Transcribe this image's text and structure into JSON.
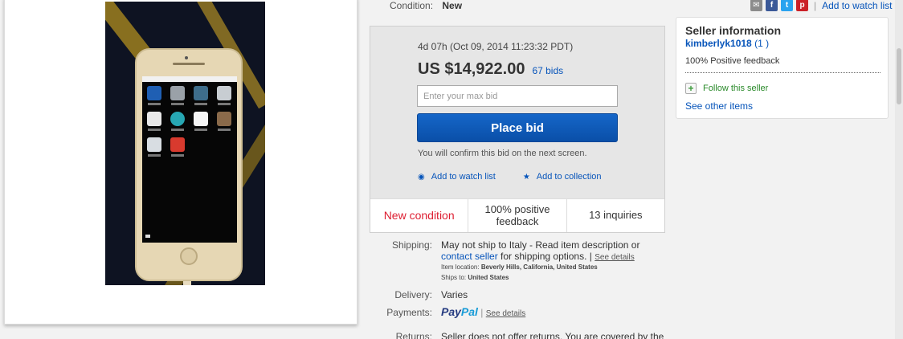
{
  "condition": {
    "label": "Condition:",
    "value": "New"
  },
  "share": {
    "watch_label": "Add to watch list"
  },
  "bid": {
    "time_left": "4d 07h (Oct 09, 2014  11:23:32 PDT)",
    "price": "US $14,922.00",
    "bids": "67 bids",
    "max_bid_placeholder": "Enter your max bid",
    "place_bid_label": "Place bid",
    "confirm_note": "You will confirm this bid on the next screen.",
    "watch_label": "Add to watch list",
    "collection_label": "Add to collection"
  },
  "stats": {
    "condition": "New condition",
    "feedback": "100% positive feedback",
    "inquiries": "13 inquiries"
  },
  "shipping": {
    "label": "Shipping:",
    "line1": "May not ship to Italy - Read item description or",
    "contact_link": "contact seller",
    "line2_rest": " for shipping options.",
    "see_details": "See details",
    "item_location_label": "Item location:",
    "item_location": "Beverly Hills, California, United States",
    "ships_to_label": "Ships to:",
    "ships_to": "United States"
  },
  "delivery": {
    "label": "Delivery:",
    "value": "Varies"
  },
  "payments": {
    "label": "Payments:",
    "brand_1": "Pay",
    "brand_2": "Pal",
    "see_details": "See details"
  },
  "returns": {
    "label": "Returns:",
    "value": "Seller does not offer returns. You are covered by the"
  },
  "seller": {
    "title": "Seller information",
    "username": "kimberlyk1018",
    "feedback_score": "(1 )",
    "positive": "100% Positive feedback",
    "follow": "Follow this seller",
    "other_items": "See other items"
  },
  "colors": {
    "link": "#0654ba",
    "place_bid": "#0a4fa8",
    "new_condition": "#dd1e31"
  },
  "icons": [
    "email-icon",
    "facebook-icon",
    "twitter-icon",
    "pinterest-icon",
    "eye-icon",
    "star-icon",
    "plus-icon"
  ]
}
